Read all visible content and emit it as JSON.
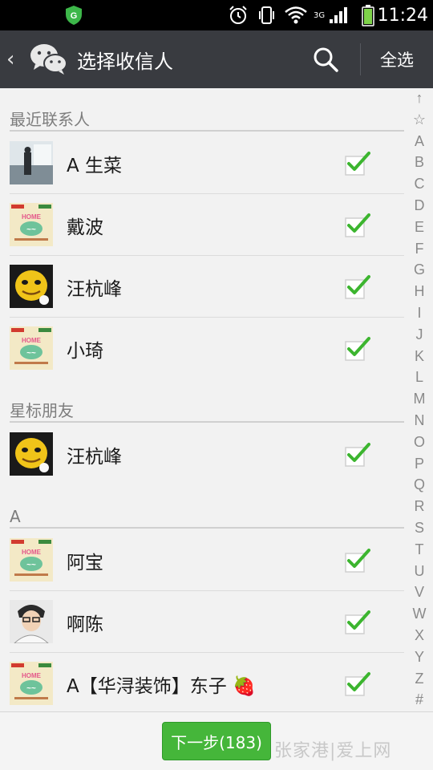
{
  "status_bar": {
    "network": "3G",
    "time": "11:24",
    "icons": [
      "shield-icon",
      "alarm-icon",
      "vibrate-icon",
      "wifi-icon",
      "signal-icon",
      "battery-icon"
    ]
  },
  "action_bar": {
    "back_glyph": "‹",
    "title": "选择收信人",
    "select_all": "全选",
    "icons": [
      "wechat-logo-icon",
      "search-icon"
    ]
  },
  "sections": [
    {
      "header": "最近联系人"
    },
    {
      "header": "星标朋友"
    },
    {
      "header": "A"
    }
  ],
  "contacts": [
    {
      "name": "A 生菜",
      "avatar": "office-photo",
      "checked": true
    },
    {
      "name": "戴波",
      "avatar": "poster",
      "checked": true
    },
    {
      "name": "汪杭峰",
      "avatar": "yellow-face",
      "checked": true
    },
    {
      "name": "小琦",
      "avatar": "poster",
      "checked": true
    },
    {
      "name": "汪杭峰",
      "avatar": "yellow-face",
      "checked": true
    },
    {
      "name": "阿宝",
      "avatar": "poster",
      "checked": true
    },
    {
      "name": "啊陈",
      "avatar": "person-photo",
      "checked": true
    },
    {
      "name": "A【华浔装饰】东子 🍓",
      "avatar": "poster",
      "checked": true
    }
  ],
  "index_letters": [
    "↑",
    "☆",
    "A",
    "B",
    "C",
    "D",
    "E",
    "F",
    "G",
    "H",
    "I",
    "J",
    "K",
    "L",
    "M",
    "N",
    "O",
    "P",
    "Q",
    "R",
    "S",
    "T",
    "U",
    "V",
    "W",
    "X",
    "Y",
    "Z",
    "#"
  ],
  "bottom": {
    "next_button": "下一步(183)",
    "watermark": "张家港|爱上网"
  },
  "colors": {
    "status_bar_bg": "#000000",
    "action_bar_bg": "#393b40",
    "accent_green": "#45b63a",
    "checkmark_green": "#3cb52f",
    "list_bg": "#f2f2f2"
  }
}
